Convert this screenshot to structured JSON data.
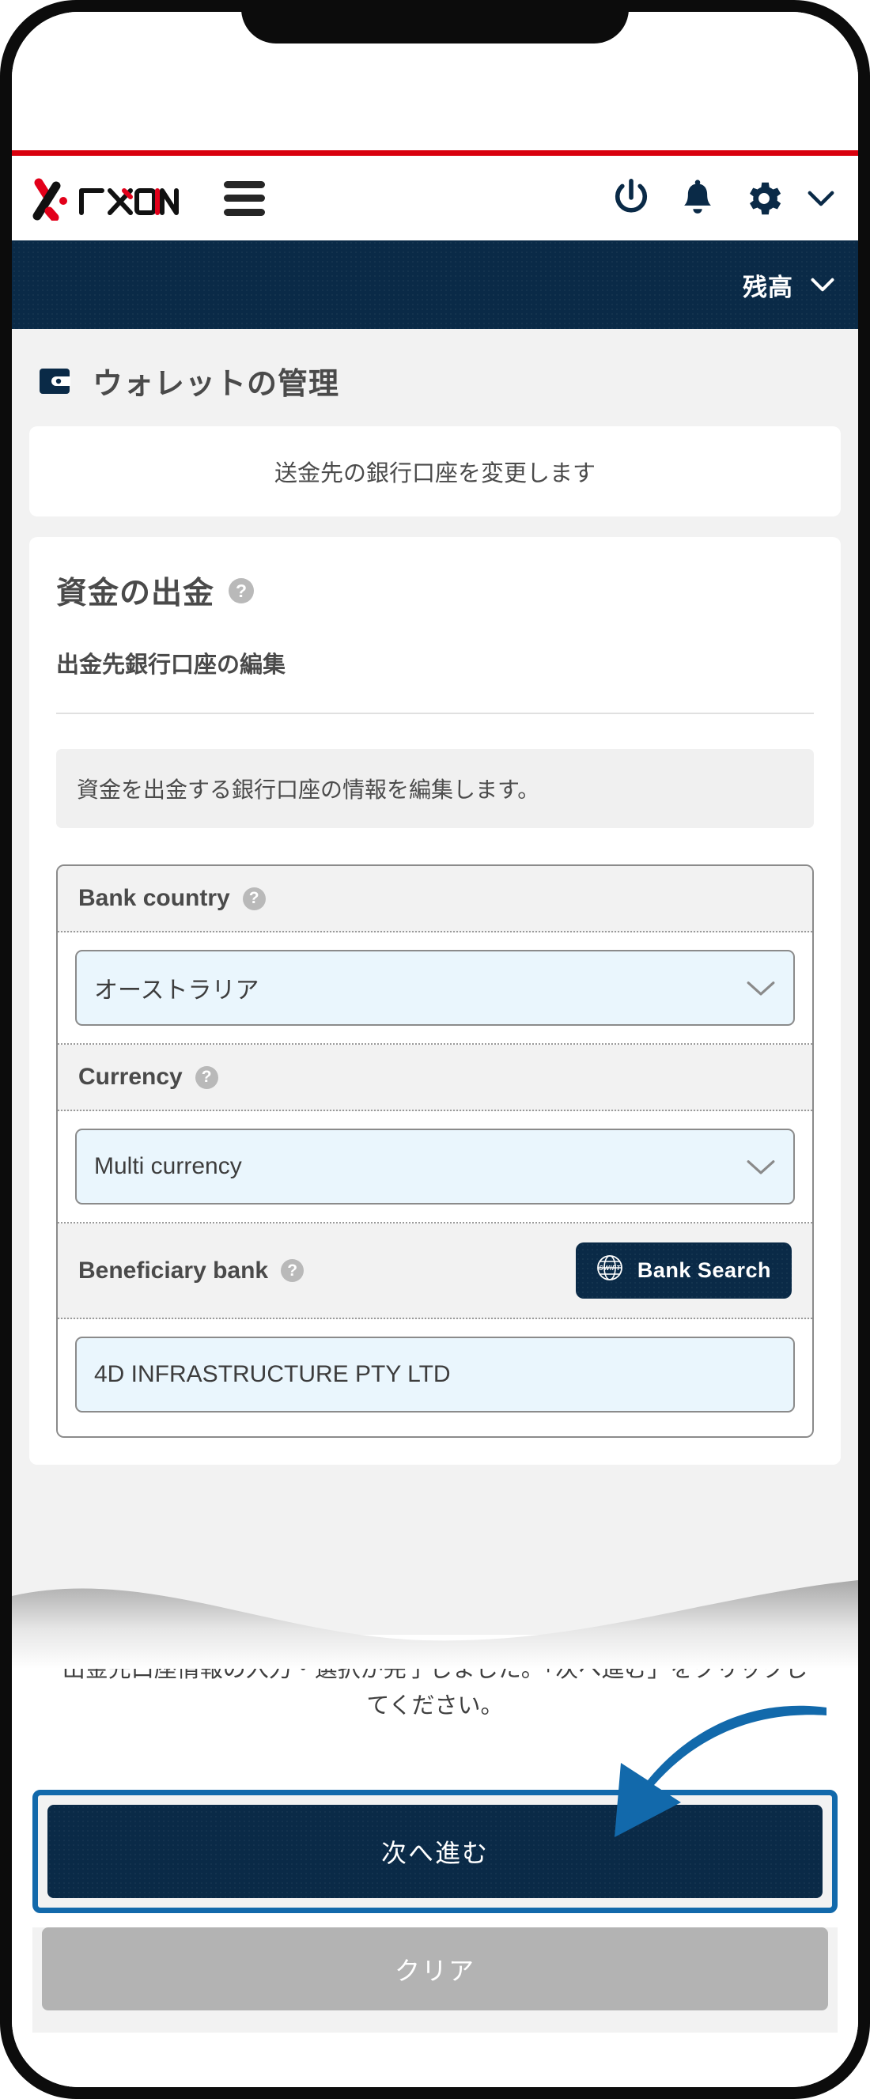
{
  "brand": {
    "logo_text": "FXON",
    "accent_red": "#d9000d",
    "navy": "#0a2a47",
    "highlight_blue": "#1269ab"
  },
  "header": {
    "logo_name": "fxon-logo",
    "menu_icon": "hamburger-icon",
    "power_icon": "power-icon",
    "bell_icon": "bell-icon",
    "gear_icon": "gear-icon",
    "caret_icon": "chevron-down-icon"
  },
  "balance_bar": {
    "label": "残高",
    "caret": "chevron-down-icon"
  },
  "page": {
    "icon": "wallet-icon",
    "title": "ウォレットの管理"
  },
  "notice": {
    "text": "送金先の銀行口座を変更します"
  },
  "section": {
    "title": "資金の出金",
    "help": "?",
    "subtitle": "出金先銀行口座の編集",
    "info": "資金を出金する銀行口座の情報を編集します。"
  },
  "form": {
    "fields": [
      {
        "label": "Bank country",
        "help": "?",
        "value": "オーストラリア",
        "type": "select"
      },
      {
        "label": "Currency",
        "help": "?",
        "value": "Multi currency",
        "type": "select"
      },
      {
        "label": "Beneficiary bank",
        "help": "?",
        "value": "4D INFRASTRUCTURE PTY LTD",
        "type": "select",
        "action_button": {
          "label": "Bank Search",
          "icon": "swift-globe-icon",
          "icon_text": "SWIFT"
        }
      }
    ]
  },
  "instruction": {
    "text": "出金先口座情報の入力・選択が完了しました。「次へ進む」をクリックしてください。"
  },
  "actions": {
    "primary_label": "次へ進む",
    "secondary_label": "クリア",
    "arrow": "curved-arrow-annotation"
  }
}
